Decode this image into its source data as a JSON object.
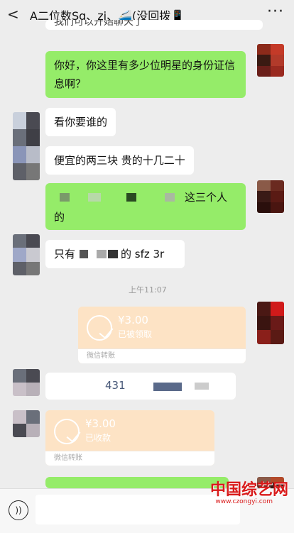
{
  "header": {
    "title": "A二位数Sg、zj、🚄(没回拨📱",
    "back_label": "<",
    "more_label": "···"
  },
  "messages": {
    "top_cut": "我们可以开始聊天了",
    "q1": "你好，你这里有多少位明星的身份证信息啊？",
    "a1": "看你要谁的",
    "a2": "便宜的两三块 贵的十几二十",
    "q2_tail": "这三个人",
    "q2_end": "的",
    "a3_prefix": "只有",
    "a3_suffix": "的 sfz 3r",
    "time": "上午11:07",
    "partial_num": "431"
  },
  "transfer1": {
    "amount": "¥3.00",
    "status": "已被领取",
    "label": "微信转账"
  },
  "transfer2": {
    "amount": "¥3.00",
    "status": "已收款",
    "label": "微信转账"
  },
  "input": {
    "voice_icon": "voice-icon"
  },
  "watermark": {
    "main": "中国综艺网",
    "sub": "www.czongyi.com"
  },
  "colors": {
    "bubble_green": "#95ec69",
    "transfer": "#fde3c5",
    "background": "#ededed"
  }
}
